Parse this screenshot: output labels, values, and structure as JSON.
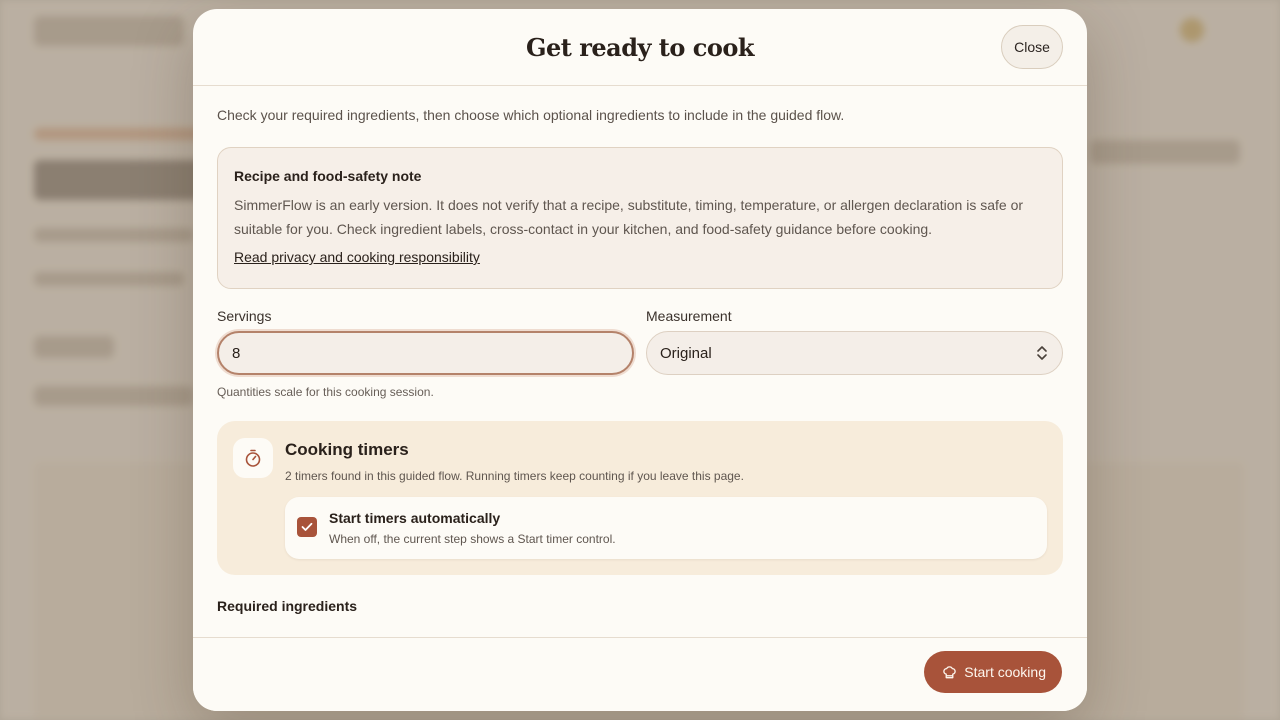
{
  "modal": {
    "title": "Get ready to cook",
    "close_label": "Close",
    "intro": "Check your required ingredients, then choose which optional ingredients to include in the guided flow."
  },
  "note": {
    "title": "Recipe and food-safety note",
    "text": "SimmerFlow is an early version. It does not verify that a recipe, substitute, timing, temperature, or allergen declaration is safe or suitable for you. Check ingredient labels, cross-contact in your kitchen, and food-safety guidance before cooking.",
    "link": "Read privacy and cooking responsibility"
  },
  "servings": {
    "label": "Servings",
    "value": "8",
    "hint": "Quantities scale for this cooking session."
  },
  "measurement": {
    "label": "Measurement",
    "selected": "Original"
  },
  "timers": {
    "title": "Cooking timers",
    "subtitle": "2 timers found in this guided flow. Running timers keep counting if you leave this page.",
    "auto_title": "Start timers automatically",
    "auto_subtitle": "When off, the current step shows a Start timer control.",
    "auto_checked": true
  },
  "required": {
    "title": "Required ingredients"
  },
  "footer": {
    "start_label": "Start cooking"
  },
  "colors": {
    "accent": "#a8533a",
    "timer_panel": "#f7ecdb",
    "modal_bg": "#fdfbf6"
  },
  "icons": {
    "timer": "stopwatch-icon",
    "checkbox": "check-icon",
    "select": "chevron-up-down-icon",
    "start": "chef-hat-icon"
  }
}
